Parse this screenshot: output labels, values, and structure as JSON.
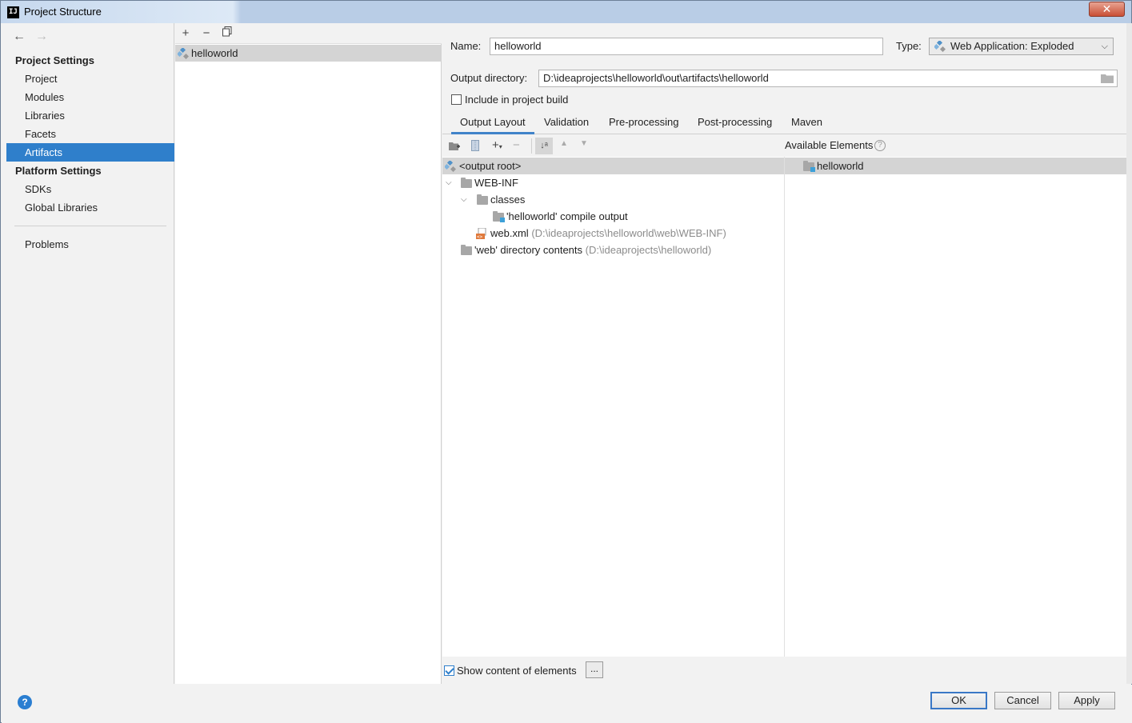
{
  "window": {
    "title": "Project Structure"
  },
  "nav": {
    "project_settings": "Project Settings",
    "platform_settings": "Platform Settings",
    "items": [
      {
        "label": "Project"
      },
      {
        "label": "Modules"
      },
      {
        "label": "Libraries"
      },
      {
        "label": "Facets"
      },
      {
        "label": "Artifacts",
        "selected": true
      },
      {
        "label": "SDKs"
      },
      {
        "label": "Global Libraries"
      },
      {
        "label": "Problems"
      }
    ]
  },
  "artifacts": {
    "items": [
      {
        "label": "helloworld"
      }
    ]
  },
  "detail": {
    "name_label": "Name:",
    "name_value": "helloworld",
    "type_label": "Type:",
    "type_value": "Web Application: Exploded",
    "output_dir_label": "Output directory:",
    "output_dir_value": "D:\\ideaprojects\\helloworld\\out\\artifacts\\helloworld",
    "include_build_label": "Include in project build",
    "include_build_checked": false,
    "tabs": [
      "Output Layout",
      "Validation",
      "Pre-processing",
      "Post-processing",
      "Maven"
    ],
    "available_elements_label": "Available Elements",
    "output_tree": {
      "root": "<output root>",
      "web_inf": "WEB-INF",
      "classes": "classes",
      "compile_output": "'helloworld' compile output",
      "web_xml": "web.xml",
      "web_xml_path": "(D:\\ideaprojects\\helloworld\\web\\WEB-INF)",
      "web_dir": "'web' directory contents",
      "web_dir_path": "(D:\\ideaprojects\\helloworld)"
    },
    "available_tree": {
      "module": "helloworld"
    },
    "show_content_label": "Show content of elements",
    "show_content_checked": true,
    "ellipsis": "..."
  },
  "footer": {
    "ok": "OK",
    "cancel": "Cancel",
    "apply": "Apply",
    "help": "?"
  },
  "colors": {
    "accent": "#2f7fcb",
    "selection": "#d4d4d4"
  }
}
